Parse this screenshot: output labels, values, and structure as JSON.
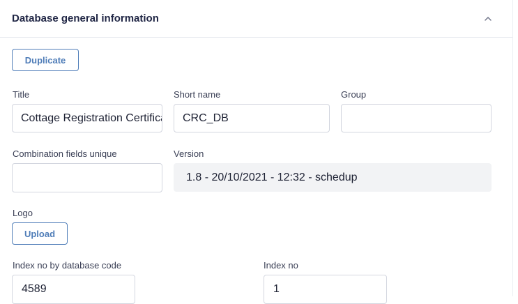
{
  "panel": {
    "title": "Database general information",
    "collapse_icon": "chevron-up-icon"
  },
  "actions": {
    "duplicate_label": "Duplicate",
    "upload_label": "Upload"
  },
  "fields": {
    "title": {
      "label": "Title",
      "value": "Cottage Registration Certificate"
    },
    "short_name": {
      "label": "Short name",
      "value": "CRC_DB"
    },
    "group": {
      "label": "Group",
      "value": ""
    },
    "combination_fields_unique": {
      "label": "Combination fields unique",
      "value": ""
    },
    "version": {
      "label": "Version",
      "value": "1.8 - 20/10/2021 - 12:32 - schedup"
    },
    "logo": {
      "label": "Logo"
    },
    "index_no_by_database_code": {
      "label": "Index no by database code",
      "value": "4589"
    },
    "index_no": {
      "label": "Index no",
      "value": "1"
    }
  }
}
